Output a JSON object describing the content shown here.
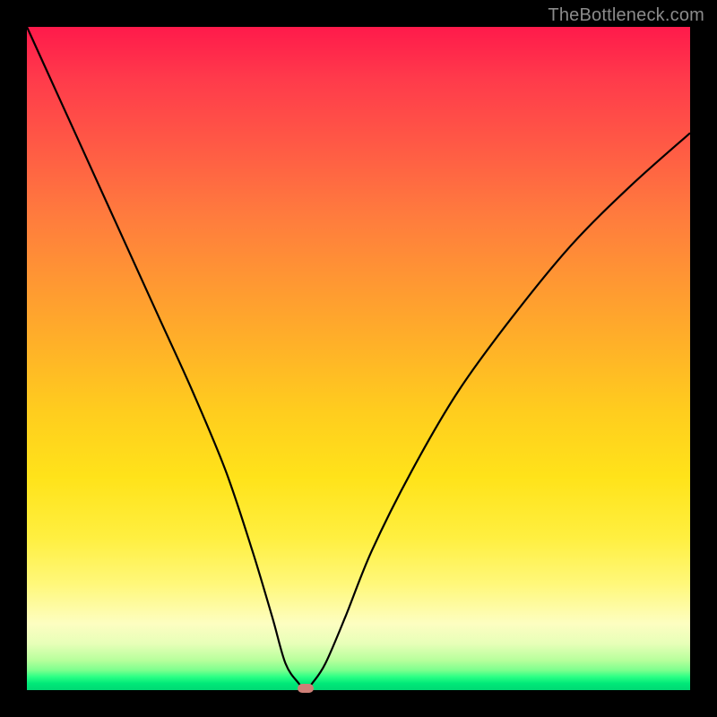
{
  "watermark": "TheBottleneck.com",
  "colors": {
    "frame_bg_top": "#ff1a4b",
    "frame_bg_bottom": "#00d874",
    "curve": "#000000",
    "indicator": "#cf7f77",
    "page_bg": "#000000",
    "watermark": "#8b8b8b"
  },
  "chart_data": {
    "type": "line",
    "title": "",
    "xlabel": "",
    "ylabel": "",
    "xlim": [
      0,
      100
    ],
    "ylim": [
      0,
      100
    ],
    "grid": false,
    "legend": false,
    "background_gradient": "vertical red→yellow→green (low y = good)",
    "series": [
      {
        "name": "bottleneck-curve",
        "x": [
          0,
          5,
          10,
          15,
          20,
          25,
          30,
          34,
          37,
          39,
          41,
          42,
          43,
          45,
          48,
          52,
          58,
          65,
          73,
          82,
          91,
          100
        ],
        "y": [
          100,
          89,
          78,
          67,
          56,
          45,
          33,
          21,
          11,
          4,
          1,
          0,
          1,
          4,
          11,
          21,
          33,
          45,
          56,
          67,
          76,
          84
        ]
      }
    ],
    "minimum_marker": {
      "x": 42,
      "y": 0
    }
  }
}
